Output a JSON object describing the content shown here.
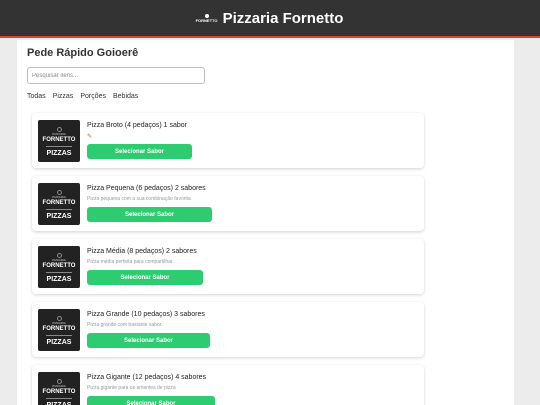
{
  "header": {
    "title": "Pizzaria Fornetto",
    "logo_text": "FORNETTO"
  },
  "store": {
    "name": "Pede Rápido Goioerê"
  },
  "search": {
    "placeholder": "Pesquisar itens..."
  },
  "categories": [
    "Todas",
    "Pizzas",
    "Porções",
    "Bebidas"
  ],
  "thumb": {
    "small": "PIZZARIA",
    "brand": "FORNETTO",
    "category": "PIZZAS"
  },
  "products": [
    {
      "title": "Pizza Broto (4 pedaços) 1 sabor",
      "description": "",
      "flag": "✎",
      "button": "Selecionar Sabor"
    },
    {
      "title": "Pizza Pequena (6 pedaços) 2 sabores",
      "description": "Pizza pequena com a sua combinação favorita",
      "button": "Selecionar Sabor"
    },
    {
      "title": "Pizza Média (8 pedaços) 2 sabores",
      "description": "Pizza média perfeita para compartilhar.",
      "button": "Selecionar Sabor"
    },
    {
      "title": "Pizza Grande (10 pedaços) 3 sabores",
      "description": "Pizza grande com bastante sabor.",
      "button": "Selecionar Sabor"
    },
    {
      "title": "Pizza Gigante (12 pedaços) 4 sabores",
      "description": "Pizza gigante para os amantes de pizza",
      "button": "Selecionar Sabor"
    }
  ],
  "colors": {
    "header_bg": "#333333",
    "accent_line": "#d6453d",
    "button": "#2ecc71"
  }
}
